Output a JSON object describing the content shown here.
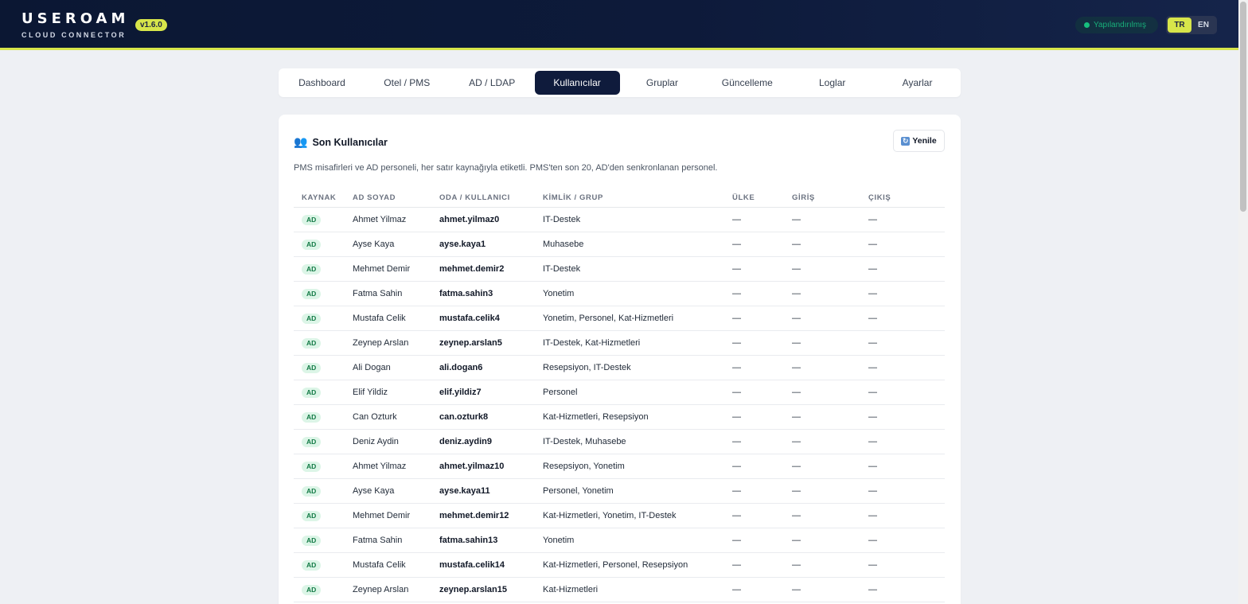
{
  "header": {
    "logo_word": "USEROAM",
    "logo_sub": "CLOUD CONNECTOR",
    "version": "v1.6.0",
    "status": "Yapılandırılmış",
    "languages": [
      {
        "label": "TR",
        "active": true
      },
      {
        "label": "EN",
        "active": false
      }
    ],
    "accent_color": "#d7e54a"
  },
  "tabs": [
    {
      "label": "Dashboard",
      "active": false
    },
    {
      "label": "Otel / PMS",
      "active": false
    },
    {
      "label": "AD / LDAP",
      "active": false
    },
    {
      "label": "Kullanıcılar",
      "active": true
    },
    {
      "label": "Gruplar",
      "active": false
    },
    {
      "label": "Güncelleme",
      "active": false
    },
    {
      "label": "Loglar",
      "active": false
    },
    {
      "label": "Ayarlar",
      "active": false
    }
  ],
  "card": {
    "icon": "users-icon",
    "title": "Son Kullanıcılar",
    "refresh_label": "Yenile",
    "description": "PMS misafirleri ve AD personeli, her satır kaynağıyla etiketli. PMS'ten son 20, AD'den senkronlanan personel."
  },
  "table": {
    "columns": [
      "KAYNAK",
      "AD SOYAD",
      "ODA / KULLANICI",
      "KİMLİK / GRUP",
      "ÜLKE",
      "GİRİŞ",
      "ÇIKIŞ"
    ],
    "rows": [
      [
        "AD",
        "Ahmet Yilmaz",
        "ahmet.yilmaz0",
        "IT-Destek",
        "—",
        "—",
        "—"
      ],
      [
        "AD",
        "Ayse Kaya",
        "ayse.kaya1",
        "Muhasebe",
        "—",
        "—",
        "—"
      ],
      [
        "AD",
        "Mehmet Demir",
        "mehmet.demir2",
        "IT-Destek",
        "—",
        "—",
        "—"
      ],
      [
        "AD",
        "Fatma Sahin",
        "fatma.sahin3",
        "Yonetim",
        "—",
        "—",
        "—"
      ],
      [
        "AD",
        "Mustafa Celik",
        "mustafa.celik4",
        "Yonetim, Personel, Kat-Hizmetleri",
        "—",
        "—",
        "—"
      ],
      [
        "AD",
        "Zeynep Arslan",
        "zeynep.arslan5",
        "IT-Destek, Kat-Hizmetleri",
        "—",
        "—",
        "—"
      ],
      [
        "AD",
        "Ali Dogan",
        "ali.dogan6",
        "Resepsiyon, IT-Destek",
        "—",
        "—",
        "—"
      ],
      [
        "AD",
        "Elif Yildiz",
        "elif.yildiz7",
        "Personel",
        "—",
        "—",
        "—"
      ],
      [
        "AD",
        "Can Ozturk",
        "can.ozturk8",
        "Kat-Hizmetleri, Resepsiyon",
        "—",
        "—",
        "—"
      ],
      [
        "AD",
        "Deniz Aydin",
        "deniz.aydin9",
        "IT-Destek, Muhasebe",
        "—",
        "—",
        "—"
      ],
      [
        "AD",
        "Ahmet Yilmaz",
        "ahmet.yilmaz10",
        "Resepsiyon, Yonetim",
        "—",
        "—",
        "—"
      ],
      [
        "AD",
        "Ayse Kaya",
        "ayse.kaya11",
        "Personel, Yonetim",
        "—",
        "—",
        "—"
      ],
      [
        "AD",
        "Mehmet Demir",
        "mehmet.demir12",
        "Kat-Hizmetleri, Yonetim, IT-Destek",
        "—",
        "—",
        "—"
      ],
      [
        "AD",
        "Fatma Sahin",
        "fatma.sahin13",
        "Yonetim",
        "—",
        "—",
        "—"
      ],
      [
        "AD",
        "Mustafa Celik",
        "mustafa.celik14",
        "Kat-Hizmetleri, Personel, Resepsiyon",
        "—",
        "—",
        "—"
      ],
      [
        "AD",
        "Zeynep Arslan",
        "zeynep.arslan15",
        "Kat-Hizmetleri",
        "—",
        "—",
        "—"
      ]
    ]
  }
}
